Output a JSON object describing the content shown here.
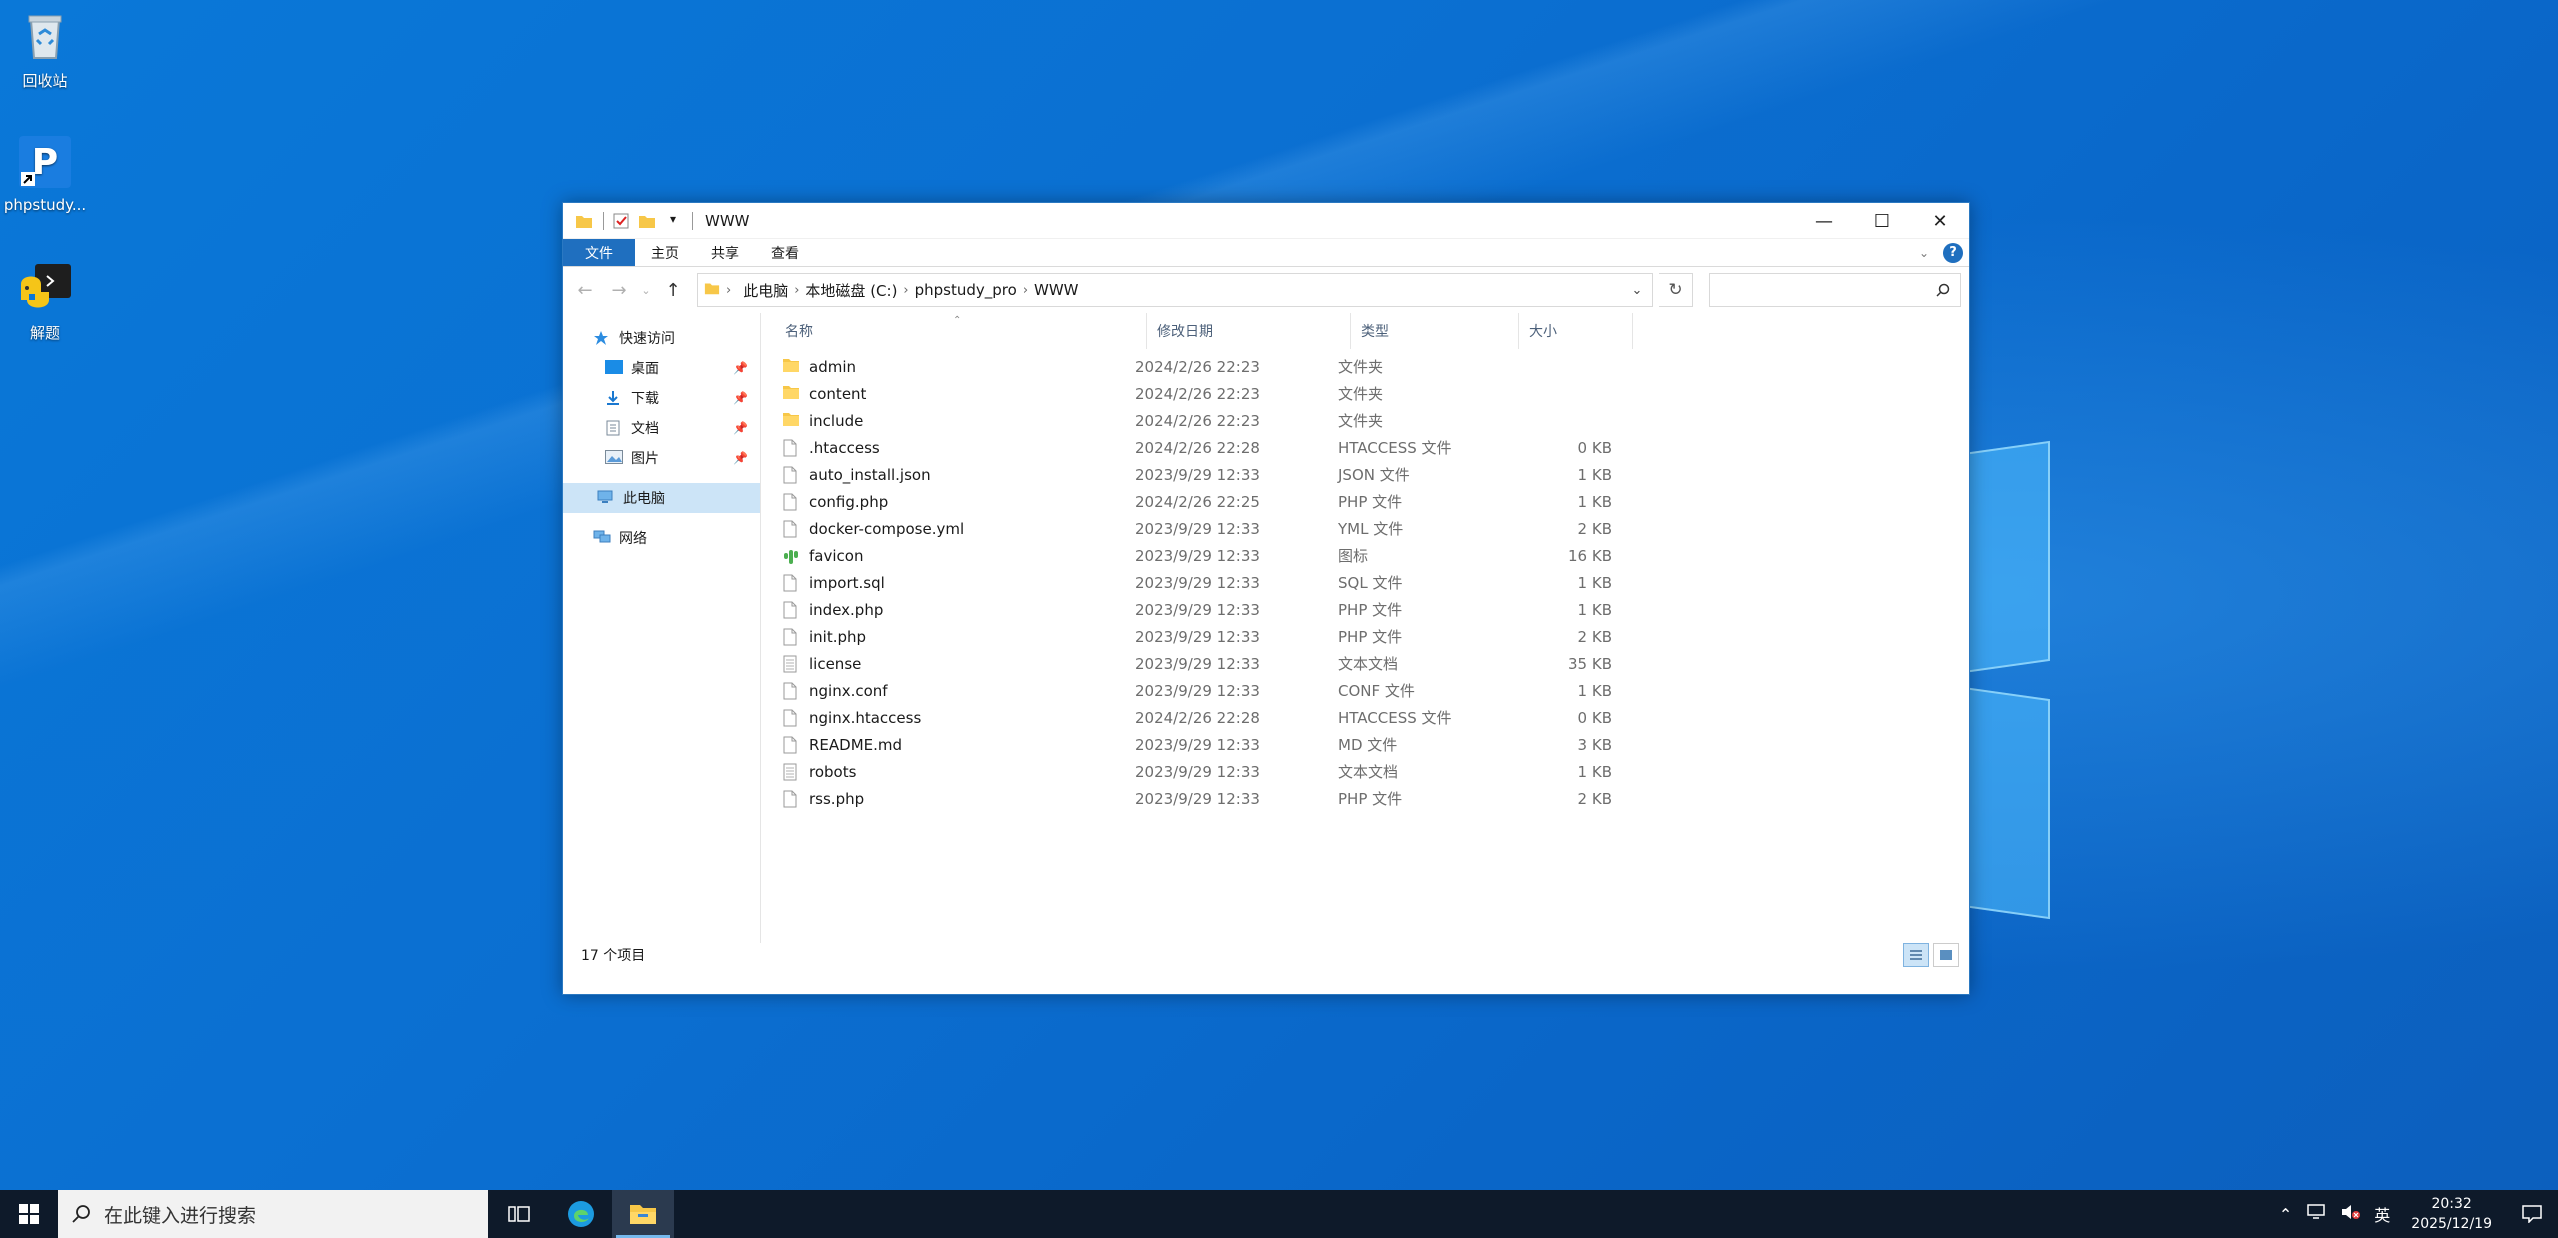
{
  "desktop": {
    "icons": [
      {
        "label": "回收站",
        "icon": "recycle-bin-icon"
      },
      {
        "label": "phpstudy...",
        "icon": "phpstudy-icon"
      },
      {
        "label": "解题",
        "icon": "python-terminal-icon"
      }
    ]
  },
  "window": {
    "title": "WWW",
    "ribbon_tabs": [
      "文件",
      "主页",
      "共享",
      "查看"
    ],
    "breadcrumbs": [
      "此电脑",
      "本地磁盘 (C:)",
      "phpstudy_pro",
      "WWW"
    ],
    "search_placeholder": "",
    "sidebar": {
      "quick_access": "快速访问",
      "pinned": [
        "桌面",
        "下载",
        "文档",
        "图片"
      ],
      "this_pc": "此电脑",
      "network": "网络"
    },
    "columns": {
      "name": "名称",
      "date": "修改日期",
      "type": "类型",
      "size": "大小"
    },
    "files": [
      {
        "name": "admin",
        "date": "2024/2/26 22:23",
        "type": "文件夹",
        "size": "",
        "kind": "folder"
      },
      {
        "name": "content",
        "date": "2024/2/26 22:23",
        "type": "文件夹",
        "size": "",
        "kind": "folder"
      },
      {
        "name": "include",
        "date": "2024/2/26 22:23",
        "type": "文件夹",
        "size": "",
        "kind": "folder"
      },
      {
        "name": ".htaccess",
        "date": "2024/2/26 22:28",
        "type": "HTACCESS 文件",
        "size": "0 KB",
        "kind": "file"
      },
      {
        "name": "auto_install.json",
        "date": "2023/9/29 12:33",
        "type": "JSON 文件",
        "size": "1 KB",
        "kind": "file"
      },
      {
        "name": "config.php",
        "date": "2024/2/26 22:25",
        "type": "PHP 文件",
        "size": "1 KB",
        "kind": "file"
      },
      {
        "name": "docker-compose.yml",
        "date": "2023/9/29 12:33",
        "type": "YML 文件",
        "size": "2 KB",
        "kind": "file"
      },
      {
        "name": "favicon",
        "date": "2023/9/29 12:33",
        "type": "图标",
        "size": "16 KB",
        "kind": "icon"
      },
      {
        "name": "import.sql",
        "date": "2023/9/29 12:33",
        "type": "SQL 文件",
        "size": "1 KB",
        "kind": "file"
      },
      {
        "name": "index.php",
        "date": "2023/9/29 12:33",
        "type": "PHP 文件",
        "size": "1 KB",
        "kind": "file"
      },
      {
        "name": "init.php",
        "date": "2023/9/29 12:33",
        "type": "PHP 文件",
        "size": "2 KB",
        "kind": "file"
      },
      {
        "name": "license",
        "date": "2023/9/29 12:33",
        "type": "文本文档",
        "size": "35 KB",
        "kind": "text"
      },
      {
        "name": "nginx.conf",
        "date": "2023/9/29 12:33",
        "type": "CONF 文件",
        "size": "1 KB",
        "kind": "file"
      },
      {
        "name": "nginx.htaccess",
        "date": "2024/2/26 22:28",
        "type": "HTACCESS 文件",
        "size": "0 KB",
        "kind": "file"
      },
      {
        "name": "README.md",
        "date": "2023/9/29 12:33",
        "type": "MD 文件",
        "size": "3 KB",
        "kind": "file"
      },
      {
        "name": "robots",
        "date": "2023/9/29 12:33",
        "type": "文本文档",
        "size": "1 KB",
        "kind": "text"
      },
      {
        "name": "rss.php",
        "date": "2023/9/29 12:33",
        "type": "PHP 文件",
        "size": "2 KB",
        "kind": "file"
      }
    ],
    "status": "17 个项目"
  },
  "taskbar": {
    "search_placeholder": "在此键入进行搜索",
    "ime": "英",
    "time": "20:32",
    "date": "2025/12/19"
  },
  "colors": {
    "accent": "#1f6fbf",
    "selected": "#cce4f7",
    "folder": "#f7c748"
  }
}
